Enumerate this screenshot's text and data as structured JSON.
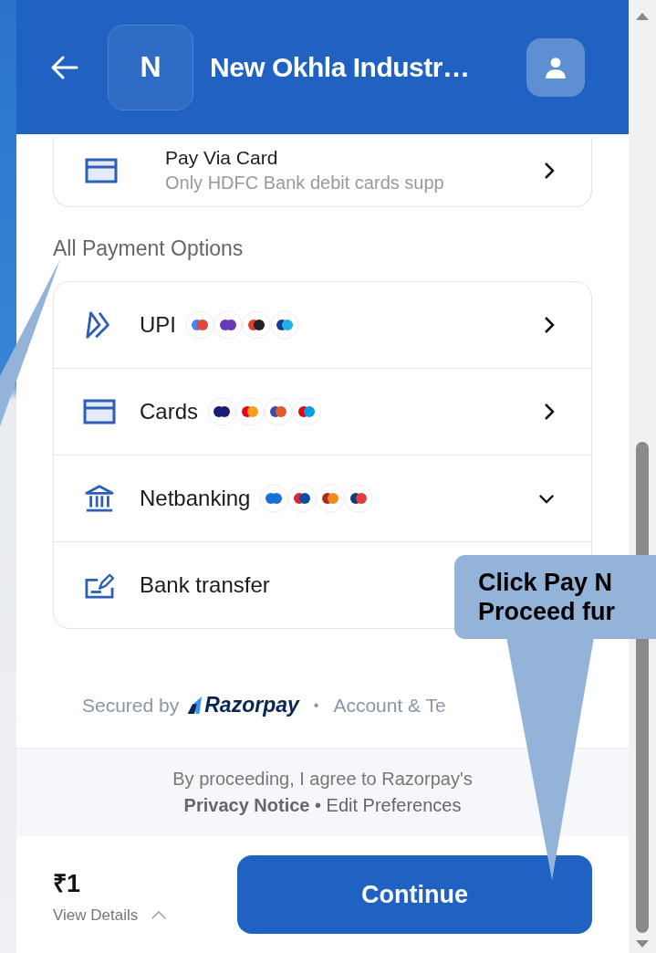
{
  "header": {
    "avatar_letter": "N",
    "title": "New Okhla Industr…"
  },
  "preferred": {
    "title": "Pay Via Card",
    "subtitle": "Only HDFC Bank debit cards supp"
  },
  "section_title": "All Payment Options",
  "options": [
    {
      "kind": "upi",
      "label": "UPI",
      "expandable": false
    },
    {
      "kind": "cards",
      "label": "Cards",
      "expandable": false
    },
    {
      "kind": "netbanking",
      "label": "Netbanking",
      "expandable": true
    },
    {
      "kind": "bank_transfer",
      "label": "Bank transfer",
      "expandable": false
    }
  ],
  "footer": {
    "secured_by": "Secured by",
    "brand": "Razorpay",
    "separator": "•",
    "link": "Account & Te"
  },
  "consent": {
    "line_1": "By proceeding, I agree to Razorpay's",
    "line_2": "**Privacy Notice** • Edit Preferences"
  },
  "bottom_bar": {
    "amount": "₹1",
    "details": "View Details",
    "button": "Continue"
  },
  "callout": {
    "lines": [
      "Click Pay N",
      "Proceed fur"
    ]
  }
}
